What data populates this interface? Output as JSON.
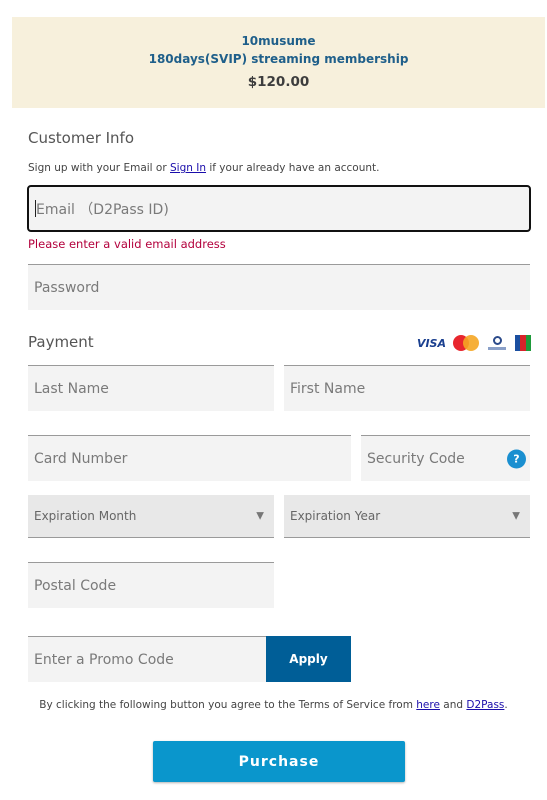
{
  "product": {
    "name": "10musume",
    "plan": "180days(SVIP) streaming membership",
    "price": "$120.00"
  },
  "customer_info": {
    "title": "Customer Info",
    "hint_prefix": "Sign up with your Email or ",
    "sign_in_link": "Sign In",
    "hint_suffix": " if your already have an account.",
    "email_placeholder": "Email （D2Pass ID)",
    "email_value": "",
    "email_error": "Please enter a valid email address",
    "password_placeholder": "Password"
  },
  "payment": {
    "title": "Payment",
    "card_brands": [
      "visa",
      "mastercard",
      "diners-club",
      "jcb"
    ],
    "visa_label": "VISA",
    "last_name_placeholder": "Last Name",
    "first_name_placeholder": "First Name",
    "card_number_placeholder": "Card Number",
    "security_code_placeholder": "Security Code",
    "help_icon_glyph": "?",
    "expiration_month_selected": "Expiration Month",
    "expiration_year_selected": "Expiration Year",
    "dropdown_arrow": "▼",
    "postal_code_placeholder": "Postal Code"
  },
  "promo": {
    "placeholder": "Enter a Promo Code",
    "apply_label": "Apply"
  },
  "terms": {
    "prefix": "By clicking the following button you agree to the Terms of Service from ",
    "here_link": "here",
    "middle": " and ",
    "d2pass_link": "D2Pass",
    "suffix": "."
  },
  "purchase_label": "Purchase",
  "colors": {
    "product_bg": "#f7f0dc",
    "product_text": "#1f5f8a",
    "error": "#b3003c",
    "apply_bg": "#005e97",
    "purchase_bg": "#0a96cc",
    "help_icon": "#1a8fd0"
  }
}
